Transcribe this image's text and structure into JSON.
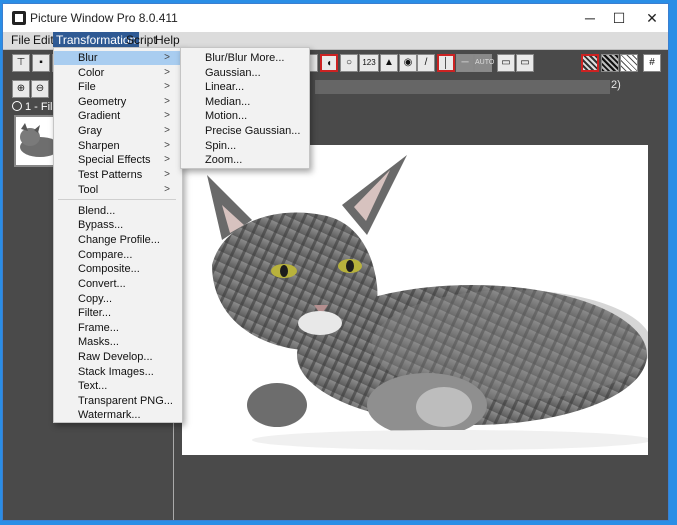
{
  "window": {
    "title": "Picture Window Pro 8.0.411"
  },
  "window_controls": {
    "minimize": "─",
    "maximize": "☐",
    "close": "✕"
  },
  "menubar": [
    "File",
    "Edit",
    "Transformation",
    "Script",
    "Help"
  ],
  "toolbar": {
    "zoom_in": "🔍",
    "counter": "123",
    "auto": "AUTO"
  },
  "status_suffix": "2)",
  "leftpane": {
    "file_label": "1 - File"
  },
  "transformation_menu": {
    "submenus": [
      "Blur",
      "Color",
      "File",
      "Geometry",
      "Gradient",
      "Gray",
      "Sharpen",
      "Special Effects",
      "Test Patterns",
      "Tool"
    ],
    "items": [
      "Blend...",
      "Bypass...",
      "Change Profile...",
      "Compare...",
      "Composite...",
      "Convert...",
      "Copy...",
      "Filter...",
      "Frame...",
      "Masks...",
      "Raw Develop...",
      "Stack Images...",
      "Text...",
      "Transparent PNG...",
      "Watermark..."
    ]
  },
  "blur_submenu": [
    "Blur/Blur More...",
    "Gaussian...",
    "Linear...",
    "Median...",
    "Motion...",
    "Precise Gaussian...",
    "Spin...",
    "Zoom..."
  ]
}
